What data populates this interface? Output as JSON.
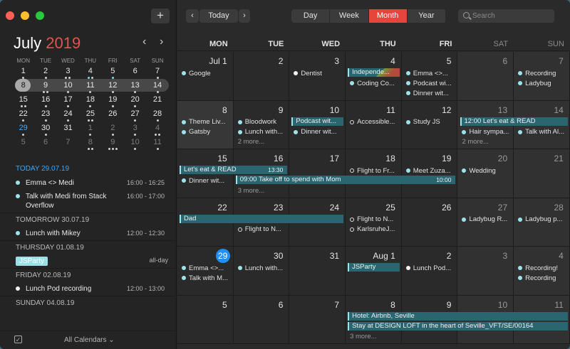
{
  "window": {
    "add_label": "+"
  },
  "sidebar": {
    "month": "July",
    "year": "2019",
    "prev": "‹",
    "next": "›",
    "dow": [
      "MON",
      "TUE",
      "WED",
      "THU",
      "FRI",
      "SAT",
      "SUN"
    ],
    "weeks": [
      [
        {
          "n": "1",
          "d": 1
        },
        {
          "n": "2",
          "d": 1
        },
        {
          "n": "3",
          "d": 2
        },
        {
          "n": "4",
          "d": 2,
          "c": 1
        },
        {
          "n": "5",
          "d": 1,
          "c": 1
        },
        {
          "n": "6",
          "d": 0
        },
        {
          "n": "7",
          "d": 1
        }
      ],
      [
        {
          "n": "8",
          "sel": true
        },
        {
          "n": "9",
          "d": 2
        },
        {
          "n": "10",
          "d": 1
        },
        {
          "n": "11",
          "d": 1
        },
        {
          "n": "12",
          "d": 1
        },
        {
          "n": "13",
          "d": 1
        },
        {
          "n": "14",
          "d": 1
        }
      ],
      [
        {
          "n": "15",
          "d": 2
        },
        {
          "n": "16",
          "d": 1
        },
        {
          "n": "17",
          "d": 1
        },
        {
          "n": "18",
          "d": 1
        },
        {
          "n": "19",
          "d": 1
        },
        {
          "n": "20",
          "d": 1
        },
        {
          "n": "21",
          "d": 0
        }
      ],
      [
        {
          "n": "22",
          "d": 1
        },
        {
          "n": "23",
          "d": 1
        },
        {
          "n": "24",
          "d": 1
        },
        {
          "n": "25",
          "d": 2
        },
        {
          "n": "26",
          "d": 0
        },
        {
          "n": "27",
          "d": 1
        },
        {
          "n": "28",
          "d": 1
        }
      ],
      [
        {
          "n": "29",
          "today": true,
          "d": 1
        },
        {
          "n": "30",
          "d": 1
        },
        {
          "n": "31",
          "d": 0
        },
        {
          "n": "1",
          "dim": true,
          "d": 1
        },
        {
          "n": "2",
          "dim": true,
          "d": 1
        },
        {
          "n": "3",
          "dim": true,
          "d": 1
        },
        {
          "n": "4",
          "dim": true,
          "d": 2
        }
      ],
      [
        {
          "n": "5",
          "dim": true
        },
        {
          "n": "6",
          "dim": true
        },
        {
          "n": "7",
          "dim": true
        },
        {
          "n": "8",
          "dim": true,
          "d": 2
        },
        {
          "n": "9",
          "dim": true,
          "d": 3
        },
        {
          "n": "10",
          "dim": true,
          "d": 1
        },
        {
          "n": "11",
          "dim": true,
          "d": 1
        }
      ]
    ],
    "agenda": [
      {
        "head": "TODAY 29.07.19",
        "first": true,
        "items": [
          {
            "title": "Emma <> Medi",
            "time": "16:00 - 16:25",
            "color": "#9de3ea"
          },
          {
            "title": "Talk with Medi from Stack Overflow",
            "time": "16:00 - 17:00",
            "color": "#9de3ea"
          }
        ]
      },
      {
        "head": "TOMORROW 30.07.19",
        "items": [
          {
            "title": "Lunch with Mikey",
            "time": "12:00 - 12:30",
            "color": "#9de3ea"
          }
        ]
      },
      {
        "head": "THURSDAY 01.08.19",
        "badge": "JSParty",
        "allday": "all-day",
        "items": []
      },
      {
        "head": "FRIDAY 02.08.19",
        "items": [
          {
            "title": "Lunch Pod recording",
            "time": "12:00 - 13:00",
            "color": "#f2f2f2"
          }
        ]
      },
      {
        "head": "SUNDAY 04.08.19",
        "items": []
      }
    ],
    "footer_label": "All Calendars ⌄"
  },
  "toolbar": {
    "prev": "‹",
    "today": "Today",
    "next": "›",
    "views": [
      "Day",
      "Week",
      "Month",
      "Year"
    ],
    "active_view": "Month",
    "search_placeholder": "Search"
  },
  "colors": {
    "accent": "#e5453a",
    "today": "#1e90ff",
    "event": "#9de3ea",
    "bar": "#2a6670"
  },
  "month": {
    "dow": [
      "MON",
      "TUE",
      "WED",
      "THU",
      "FRI",
      "SAT",
      "SUN"
    ],
    "weeks": [
      {
        "days": [
          {
            "n": "Jul 1",
            "ev": [
              {
                "t": "Google",
                "c": "#9de3ea"
              }
            ]
          },
          {
            "n": "2",
            "ev": []
          },
          {
            "n": "3",
            "ev": [
              {
                "t": "Dentist",
                "c": "#f2f2f2"
              }
            ]
          },
          {
            "n": "4",
            "ev": [
              {
                "t": "",
                "c": ""
              },
              {
                "t": "Coding Co...",
                "c": "#9de3ea"
              }
            ]
          },
          {
            "n": "5",
            "ev": [
              {
                "t": "Emma <>...",
                "c": "#9de3ea"
              },
              {
                "t": "Podcast wi...",
                "c": "#9de3ea"
              },
              {
                "t": "Dinner wit...",
                "c": "#9de3ea"
              }
            ]
          },
          {
            "n": "6",
            "wknd": true,
            "ev": []
          },
          {
            "n": "7",
            "wknd": true,
            "ev": [
              {
                "t": "Recording",
                "c": "#9de3ea"
              },
              {
                "t": "Ladybug",
                "c": "#9de3ea"
              }
            ]
          }
        ],
        "bars": [
          {
            "label": "Independe...",
            "start": 3,
            "span": 1,
            "row": 0,
            "stripe": true
          }
        ]
      },
      {
        "days": [
          {
            "n": "8",
            "past": true,
            "ev": [
              {
                "t": "Theme Liv...",
                "c": "#9de3ea"
              },
              {
                "t": "Gatsby",
                "c": "#9de3ea"
              }
            ]
          },
          {
            "n": "9",
            "ev": [
              {
                "t": "Bloodwork",
                "c": "#9de3ea"
              },
              {
                "t": "Lunch with...",
                "c": "#9de3ea"
              },
              {
                "t": "2 more...",
                "more": true
              }
            ]
          },
          {
            "n": "10",
            "ev": [
              {
                "t": "",
                "c": ""
              },
              {
                "t": "Dinner wit...",
                "c": "#9de3ea"
              }
            ]
          },
          {
            "n": "11",
            "ev": [
              {
                "t": "Accessible...",
                "c": "#e0e0e0",
                "ring": true
              }
            ]
          },
          {
            "n": "12",
            "ev": [
              {
                "t": "Study JS",
                "c": "#9de3ea"
              }
            ]
          },
          {
            "n": "13",
            "wknd": true,
            "ev": [
              {
                "t": "",
                "c": ""
              },
              {
                "t": "Hair sympa...",
                "c": "#9de3ea"
              },
              {
                "t": "2 more...",
                "more": true
              }
            ]
          },
          {
            "n": "14",
            "wknd": true,
            "ev": [
              {
                "t": "",
                "c": ""
              },
              {
                "t": "Talk with Al...",
                "c": "#9de3ea"
              }
            ]
          }
        ],
        "bars": [
          {
            "label": "Podcast wit...",
            "start": 2,
            "span": 1,
            "row": 0
          },
          {
            "label": "Let's eat & READ",
            "time": "12:00",
            "start": 5,
            "span": 2,
            "row": 0,
            "timeFirst": true
          }
        ]
      },
      {
        "days": [
          {
            "n": "15",
            "ev": [
              {
                "t": "",
                "c": ""
              },
              {
                "t": "Dinner wit...",
                "c": "#9de3ea"
              }
            ]
          },
          {
            "n": "16",
            "ev": []
          },
          {
            "n": "17",
            "ev": []
          },
          {
            "n": "18",
            "ev": [
              {
                "t": "Flight to Fr...",
                "c": "#e0e0e0",
                "ring": true
              }
            ]
          },
          {
            "n": "19",
            "ev": [
              {
                "t": "Meet Zuza...",
                "c": "#9de3ea"
              }
            ]
          },
          {
            "n": "20",
            "wknd": true,
            "ev": [
              {
                "t": "Wedding",
                "c": "#9de3ea"
              }
            ]
          },
          {
            "n": "21",
            "wknd": true,
            "ev": []
          }
        ],
        "bars": [
          {
            "label": "Let's eat & READ",
            "time": "13:30",
            "start": 0,
            "span": 2,
            "row": 0
          },
          {
            "label": "Take off to spend with Mom",
            "time": "10:00",
            "start": 1,
            "span": 4,
            "row": 1,
            "timeFirst": true,
            "time2": "09:00"
          }
        ],
        "more": [
          {
            "col": 1,
            "t": "3 more..."
          }
        ]
      },
      {
        "days": [
          {
            "n": "22",
            "ev": []
          },
          {
            "n": "23",
            "ev": [
              {
                "t": "",
                "c": ""
              },
              {
                "t": "Flight to N...",
                "c": "#e0e0e0",
                "ring": true
              }
            ]
          },
          {
            "n": "24",
            "ev": []
          },
          {
            "n": "25",
            "ev": [
              {
                "t": "Flight to N...",
                "c": "#e0e0e0",
                "ring": true
              },
              {
                "t": "KarlsruheJ...",
                "c": "#e0e0e0",
                "ring": true
              }
            ]
          },
          {
            "n": "26",
            "ev": []
          },
          {
            "n": "27",
            "wknd": true,
            "ev": [
              {
                "t": "Ladybug R...",
                "c": "#9de3ea"
              }
            ]
          },
          {
            "n": "28",
            "wknd": true,
            "ev": [
              {
                "t": "Ladybug p...",
                "c": "#9de3ea"
              }
            ]
          }
        ],
        "bars": [
          {
            "label": "Dad",
            "start": 0,
            "span": 3,
            "row": 0
          }
        ]
      },
      {
        "days": [
          {
            "n": "29",
            "today": true,
            "ev": [
              {
                "t": "Emma <>...",
                "c": "#9de3ea"
              },
              {
                "t": "Talk with M...",
                "c": "#9de3ea"
              }
            ]
          },
          {
            "n": "30",
            "ev": [
              {
                "t": "Lunch with...",
                "c": "#9de3ea"
              }
            ]
          },
          {
            "n": "31",
            "ev": []
          },
          {
            "n": "Aug 1",
            "ev": []
          },
          {
            "n": "2",
            "ev": [
              {
                "t": "Lunch Pod...",
                "c": "#f2f2f2"
              }
            ]
          },
          {
            "n": "3",
            "wknd": true,
            "ev": []
          },
          {
            "n": "4",
            "wknd": true,
            "ev": [
              {
                "t": "Recording!",
                "c": "#9de3ea"
              },
              {
                "t": "Recording",
                "c": "#9de3ea"
              }
            ]
          }
        ],
        "bars": [
          {
            "label": "JSParty",
            "start": 3,
            "span": 1,
            "row": 0
          }
        ]
      },
      {
        "days": [
          {
            "n": "5",
            "ev": []
          },
          {
            "n": "6",
            "ev": []
          },
          {
            "n": "7",
            "ev": []
          },
          {
            "n": "8",
            "ev": []
          },
          {
            "n": "9",
            "ev": []
          },
          {
            "n": "10",
            "wknd": true,
            "ev": []
          },
          {
            "n": "11",
            "wknd": true,
            "ev": []
          }
        ],
        "bars": [
          {
            "label": "Hotel: Airbnb, Seville",
            "start": 3,
            "span": 4,
            "row": 0
          },
          {
            "label": "Stay at DESIGN LOFT in the heart of Seville_VFT/SE/00164",
            "start": 3,
            "span": 4,
            "row": 1
          }
        ],
        "more": [
          {
            "col": 3,
            "t": "3 more..."
          }
        ]
      }
    ]
  }
}
